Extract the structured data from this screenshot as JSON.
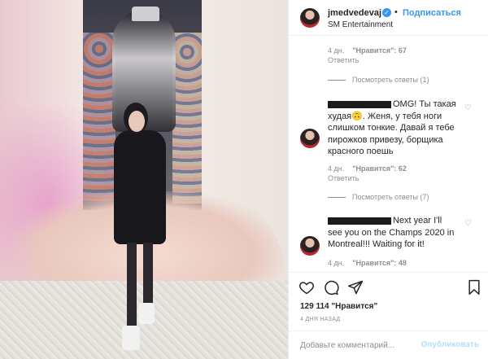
{
  "header": {
    "username": "jmedvedevaj",
    "verified_glyph": "✓",
    "separator": "•",
    "follow_label": "Подписаться",
    "subtitle": "SM Entertainment"
  },
  "comments": {
    "top_meta": {
      "time": "4 дн.",
      "likes": "\"Нравится\": 67",
      "reply": "Ответить"
    },
    "replies_toggle_1": "Посмотреть ответы (1)",
    "comment_1": {
      "text_after_redaction": "OMG! Ты такая",
      "line2": "худая🙃. Женя, у тебя ноги",
      "line3": "слишком тонкие. Давай я тебе",
      "line4": "пирожков привезу, борщика",
      "line5": "красного поешь",
      "time": "4 дн.",
      "likes": "\"Нравится\": 62",
      "reply": "Ответить"
    },
    "replies_toggle_2": "Посмотреть ответы (7)",
    "comment_2": {
      "text_after_redaction": "Next year I'll",
      "line2": "see you on the Champs 2020 in",
      "line3": "Montreal!!! Waiting for it!",
      "time": "4 дн.",
      "likes": "\"Нравится\": 48"
    }
  },
  "actions": {
    "icons": [
      "heart-icon",
      "comment-icon",
      "share-icon",
      "bookmark-icon"
    ],
    "likes_count": "129 114",
    "likes_word": "\"Нравится\"",
    "post_date": "4 ДНЯ НАЗАД"
  },
  "add_comment": {
    "placeholder": "Добавьте комментарий...",
    "publish_label": "Опубликовать"
  }
}
